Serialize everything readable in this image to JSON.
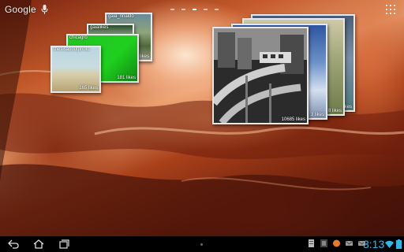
{
  "search": {
    "label": "Google"
  },
  "widget_small": {
    "cards": [
      {
        "caption": "gaia_rinaldo",
        "likes": "636 likes"
      },
      {
        "caption": "gaialikes",
        "likes": ""
      },
      {
        "caption": "chicagro",
        "likes": "181 likes"
      },
      {
        "caption": "thesisaboutphoto",
        "likes": "165 likes"
      }
    ]
  },
  "widget_large": {
    "cards": [
      {
        "caption": "",
        "likes": "10685 likes"
      },
      {
        "caption": "",
        "likes": "3 likes"
      },
      {
        "caption": "",
        "likes": "8 likes"
      },
      {
        "caption": "",
        "likes": "6 likes"
      }
    ]
  },
  "status": {
    "time": "3:13",
    "accent": "#33b5e5"
  },
  "icons": [
    "mic-icon",
    "apps-icon",
    "back-icon",
    "home-icon",
    "recent-apps-icon",
    "notification-icon",
    "wifi-icon",
    "battery-icon"
  ]
}
